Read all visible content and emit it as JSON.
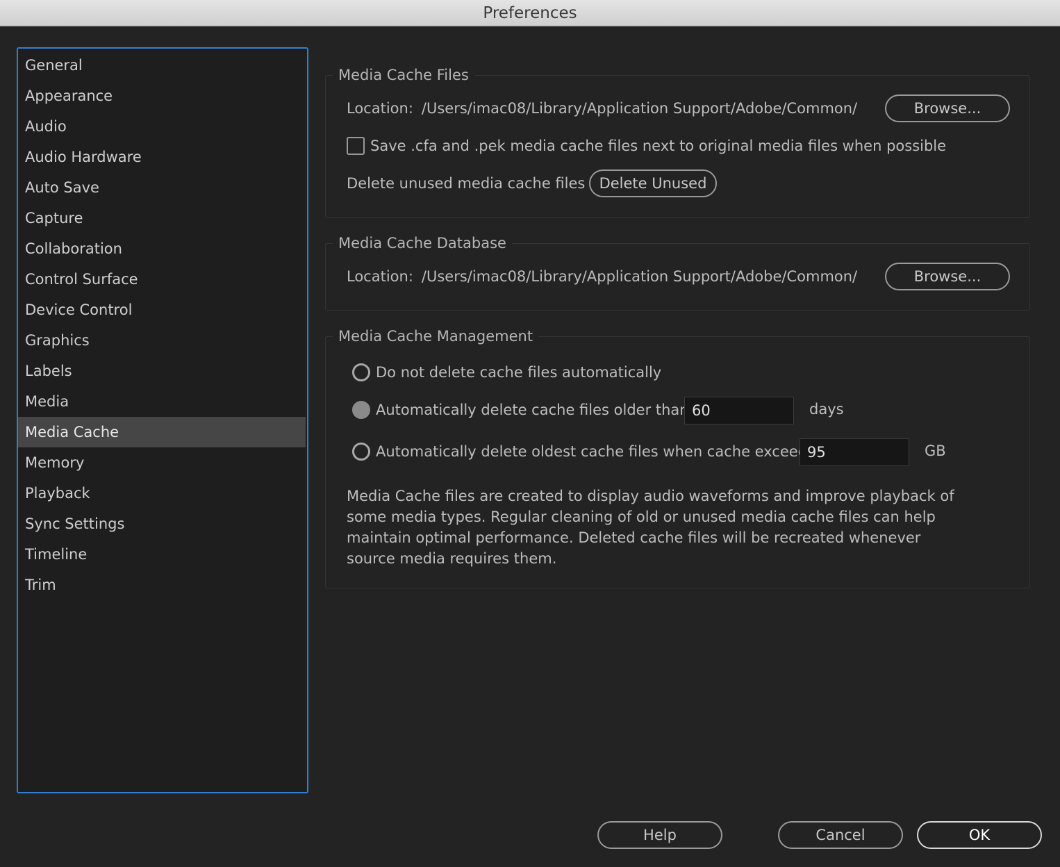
{
  "window": {
    "title": "Preferences"
  },
  "sidebar": {
    "items": [
      {
        "label": "General"
      },
      {
        "label": "Appearance"
      },
      {
        "label": "Audio"
      },
      {
        "label": "Audio Hardware"
      },
      {
        "label": "Auto Save"
      },
      {
        "label": "Capture"
      },
      {
        "label": "Collaboration"
      },
      {
        "label": "Control Surface"
      },
      {
        "label": "Device Control"
      },
      {
        "label": "Graphics"
      },
      {
        "label": "Labels"
      },
      {
        "label": "Media"
      },
      {
        "label": "Media Cache",
        "selected": true
      },
      {
        "label": "Memory"
      },
      {
        "label": "Playback"
      },
      {
        "label": "Sync Settings"
      },
      {
        "label": "Timeline"
      },
      {
        "label": "Trim"
      }
    ]
  },
  "cache_files": {
    "legend": "Media Cache Files",
    "location_label": "Location:",
    "location_path": "/Users/imac08/Library/Application Support/Adobe/Common/",
    "browse_label": "Browse...",
    "save_next_label": "Save .cfa and .pek media cache files next to original media files when possible",
    "save_next_checked": false,
    "delete_unused_text": "Delete unused media cache files",
    "delete_unused_button": "Delete Unused"
  },
  "cache_database": {
    "legend": "Media Cache Database",
    "location_label": "Location:",
    "location_path": "/Users/imac08/Library/Application Support/Adobe/Common/",
    "browse_label": "Browse..."
  },
  "cache_management": {
    "legend": "Media Cache Management",
    "option_no_delete": "Do not delete cache files automatically",
    "option_older_than": "Automatically delete cache files older than:",
    "older_than_value": "60",
    "older_than_unit": "days",
    "option_exceeds": "Automatically delete oldest cache files when cache exceeds:",
    "exceeds_value": "95",
    "exceeds_unit": "GB",
    "selected_option": "older_than",
    "description": "Media Cache files are created to display audio waveforms and improve playback of some media types.  Regular cleaning of old or unused media cache files can help maintain optimal performance. Deleted cache files will be recreated whenever source media requires them."
  },
  "footer": {
    "help_label": "Help",
    "cancel_label": "Cancel",
    "ok_label": "OK"
  }
}
